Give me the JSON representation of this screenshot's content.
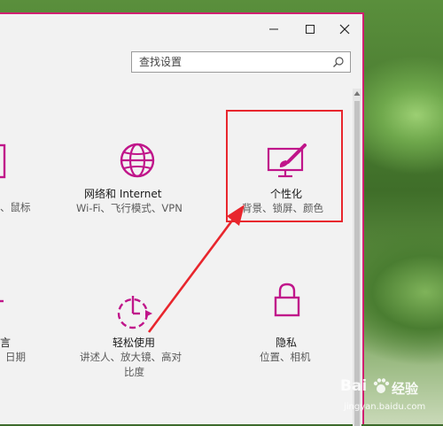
{
  "search": {
    "placeholder": "查找设置"
  },
  "tiles": {
    "left_top": {
      "desc": "、鼠标"
    },
    "network": {
      "title": "网络和 Internet",
      "desc": "Wi-Fi、飞行模式、VPN"
    },
    "personalization": {
      "title": "个性化",
      "desc": "背景、锁屏、颜色"
    },
    "left_bottom": {
      "title": "言",
      "desc": "日期"
    },
    "ease": {
      "title": "轻松使用",
      "desc_line1": "讲述人、放大镜、高对",
      "desc_line2": "比度"
    },
    "privacy": {
      "title": "隐私",
      "desc": "位置、相机"
    }
  },
  "watermark": {
    "logo": "Bai",
    "text": "经验",
    "url": "jingyan.baidu.com"
  },
  "colors": {
    "accent": "#d02070",
    "annotation": "#e8262d"
  }
}
